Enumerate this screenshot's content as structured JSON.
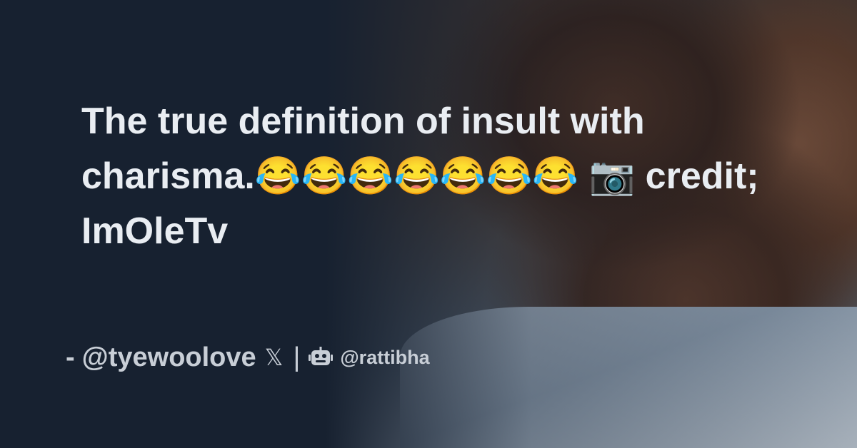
{
  "post": {
    "text": "The true definition of insult with charisma.😂😂😂😂😂😂😂 📷 credit; ImOleTv"
  },
  "footer": {
    "dash": "-",
    "author": "@tyewoolove",
    "platform_icon": "x-logo-icon",
    "platform_glyph": "𝕏",
    "separator": "|",
    "brand_icon": "robot-icon",
    "brand": "@rattibha"
  },
  "colors": {
    "background": "#172130",
    "text": "#e9edf2",
    "footer_text": "#c8ced6"
  }
}
